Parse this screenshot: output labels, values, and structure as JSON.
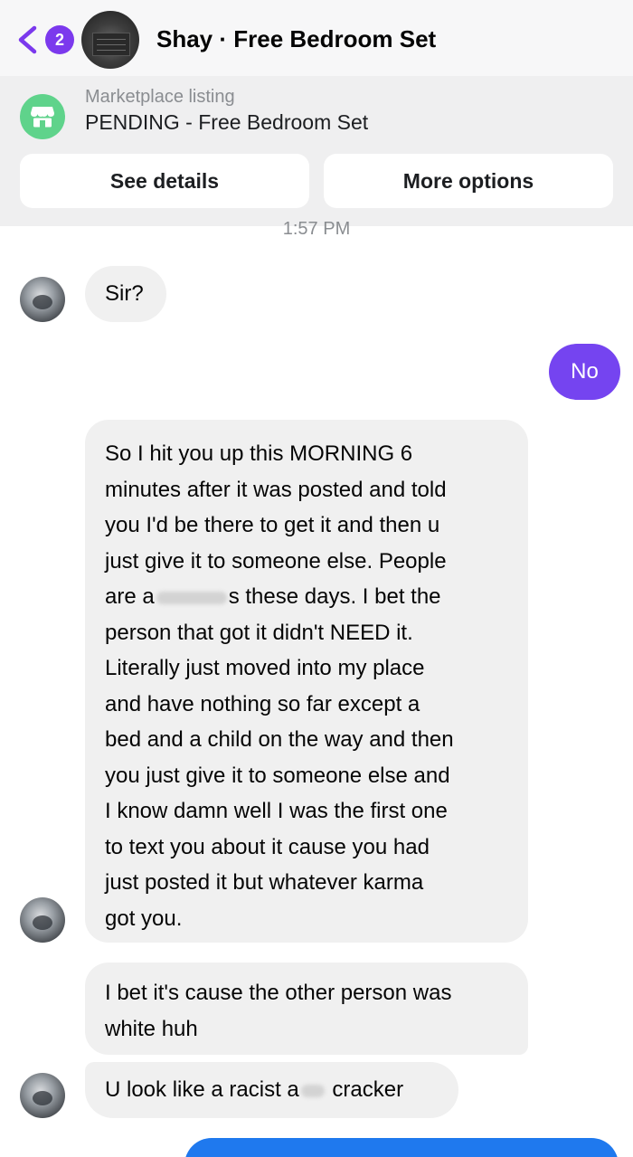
{
  "header": {
    "back_badge": "2",
    "title": "Shay · Free Bedroom Set"
  },
  "listing": {
    "label": "Marketplace listing",
    "title": "PENDING - Free Bedroom Set",
    "buttons": {
      "details": "See details",
      "options": "More options"
    }
  },
  "chat": {
    "timestamp": "1:57 PM",
    "messages": [
      {
        "from": "them",
        "text": "Sir?"
      },
      {
        "from": "me",
        "text": "No"
      },
      {
        "from": "them",
        "lines": [
          "So I hit you up this MORNING 6",
          "minutes after it was posted and told",
          "you I'd be there to get it and then u",
          "just give it to someone else. People",
          "are a",
          "s these days. I bet the",
          "person that got it didn't NEED it.",
          "Literally just moved into my place",
          "and have nothing so far except a",
          "bed and a child on the way and then",
          "you just give it to someone else and",
          "I know damn well I was the first one",
          "to text you about it cause you had",
          "just posted it but whatever karma",
          "got you."
        ]
      },
      {
        "from": "them",
        "lines": [
          "I bet it's cause the other person was",
          "white huh"
        ]
      },
      {
        "from": "them",
        "parts": [
          "U look like a racist a",
          "cracker"
        ]
      }
    ]
  },
  "colors": {
    "accent": "#7544f0",
    "badge": "#7b39ed",
    "marketplace_green": "#5fd38b",
    "incoming_bubble": "#f0f0f0",
    "outgoing_blue": "#1f79ee"
  },
  "icons": {
    "back": "chevron-left-icon",
    "marketplace": "storefront-icon"
  }
}
